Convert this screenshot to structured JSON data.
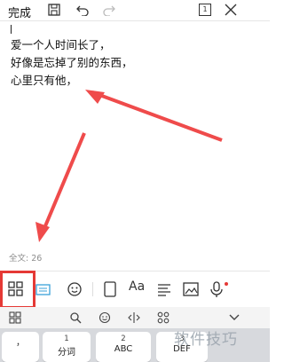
{
  "topbar": {
    "done_label": "完成",
    "page_counter": "1",
    "icons": [
      "save-icon",
      "undo-icon",
      "redo-icon",
      "page-view-icon",
      "close-icon"
    ]
  },
  "editor": {
    "lines": [
      "爱一个人时间长了，",
      "好像是忘掉了别的东西，",
      "心里只有他，"
    ],
    "word_count": "全文: 26"
  },
  "toolbar": {
    "icons": [
      "apps-grid-icon",
      "keyboard-icon",
      "emoji-icon",
      "notebook-icon",
      "font-icon",
      "align-icon",
      "image-icon",
      "microphone-icon"
    ]
  },
  "keyboard": {
    "row1_icons": [
      "grid-icon",
      "search-icon",
      "emoji-icon",
      "cursor-move-icon",
      "more-apps-icon",
      "chevron-down-icon"
    ],
    "keys": [
      {
        "num": "",
        "label": "，"
      },
      {
        "num": "1",
        "label": "分词"
      },
      {
        "num": "2",
        "label": "ABC"
      },
      {
        "num": "3",
        "label": "DEF"
      }
    ]
  },
  "watermark": "软件技巧",
  "colors": {
    "highlight_red": "#e53935",
    "arrow_red": "#ef4b4b",
    "mic_dot": "#e53935"
  }
}
